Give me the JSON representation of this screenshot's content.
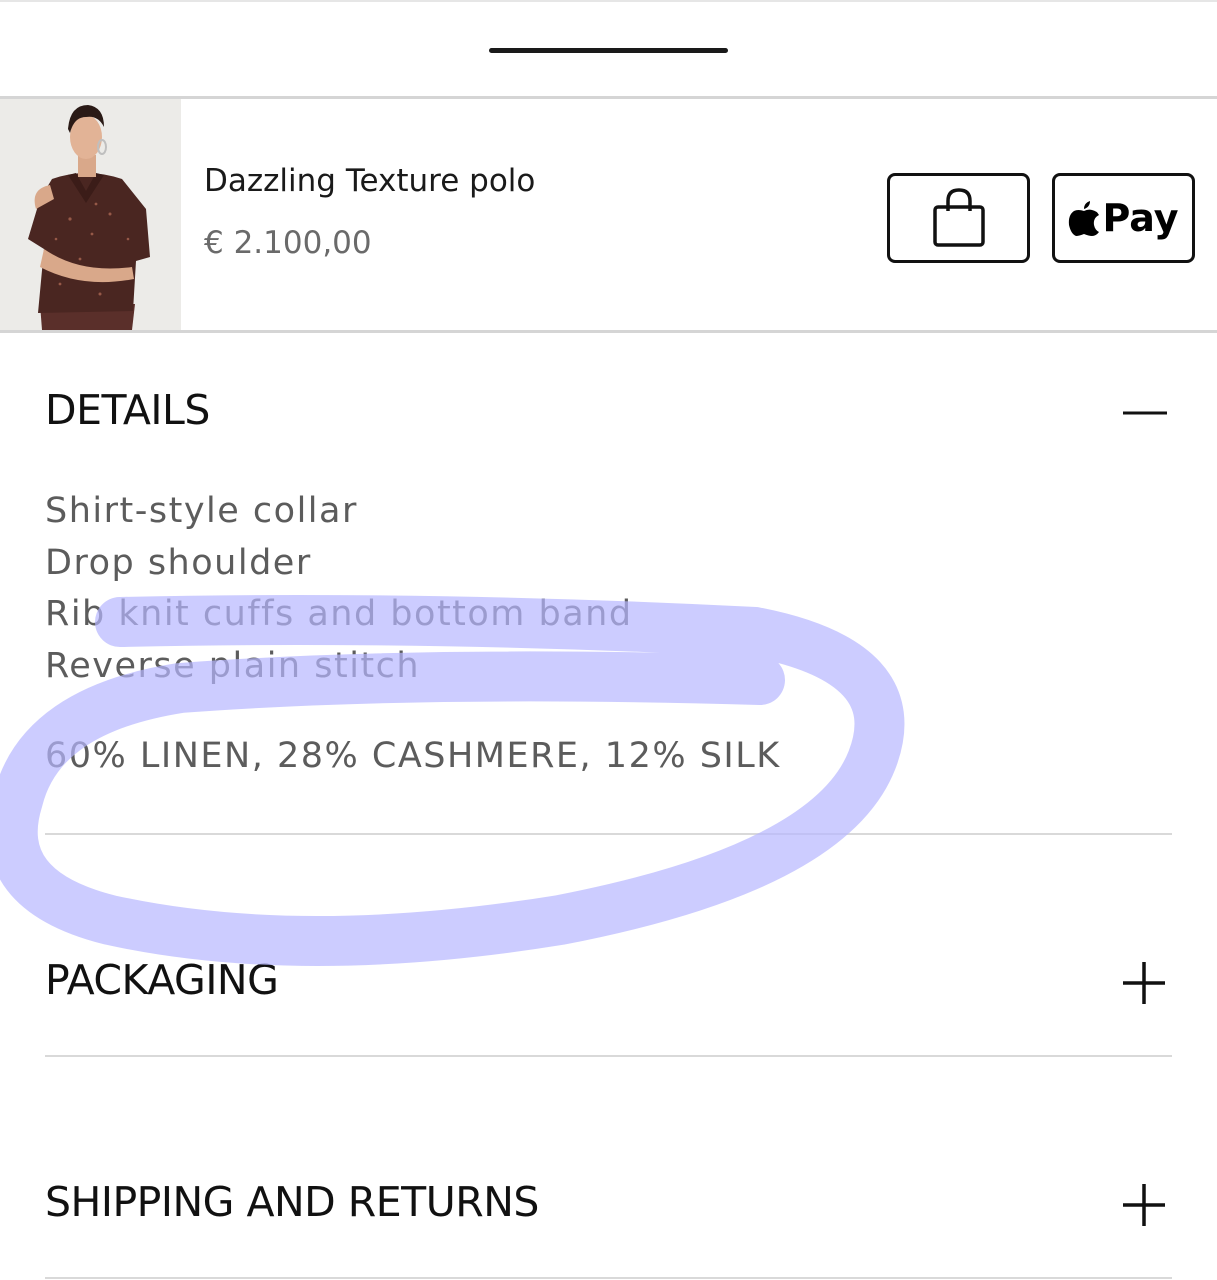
{
  "product": {
    "name": "Dazzling Texture polo",
    "price": "€ 2.100,00",
    "thumbnail_icon": "model-wearing-polo-image"
  },
  "actions": {
    "add_to_bag_icon": "shopping-bag-icon",
    "apple_pay_label": "Pay",
    "apple_pay_icon": "apple-logo-icon"
  },
  "sections": [
    {
      "title": "DETAILS",
      "expanded": true,
      "toggle_icon": "minus-icon",
      "lines": [
        "Shirt-style collar",
        "Drop shoulder",
        "Rib knit cuffs and bottom band",
        "Reverse plain stitch"
      ],
      "composition": "60% LINEN, 28% CASHMERE, 12% SILK"
    },
    {
      "title": "PACKAGING",
      "expanded": false,
      "toggle_icon": "plus-icon"
    },
    {
      "title": "SHIPPING AND RETURNS",
      "expanded": false,
      "toggle_icon": "plus-icon"
    }
  ],
  "annotation": {
    "type": "hand-drawn-ellipse",
    "color": "#b7b6ff",
    "target": "composition"
  },
  "colors": {
    "text_primary": "#111111",
    "text_secondary": "#5c5c5c",
    "divider": "#d9d9d9"
  }
}
